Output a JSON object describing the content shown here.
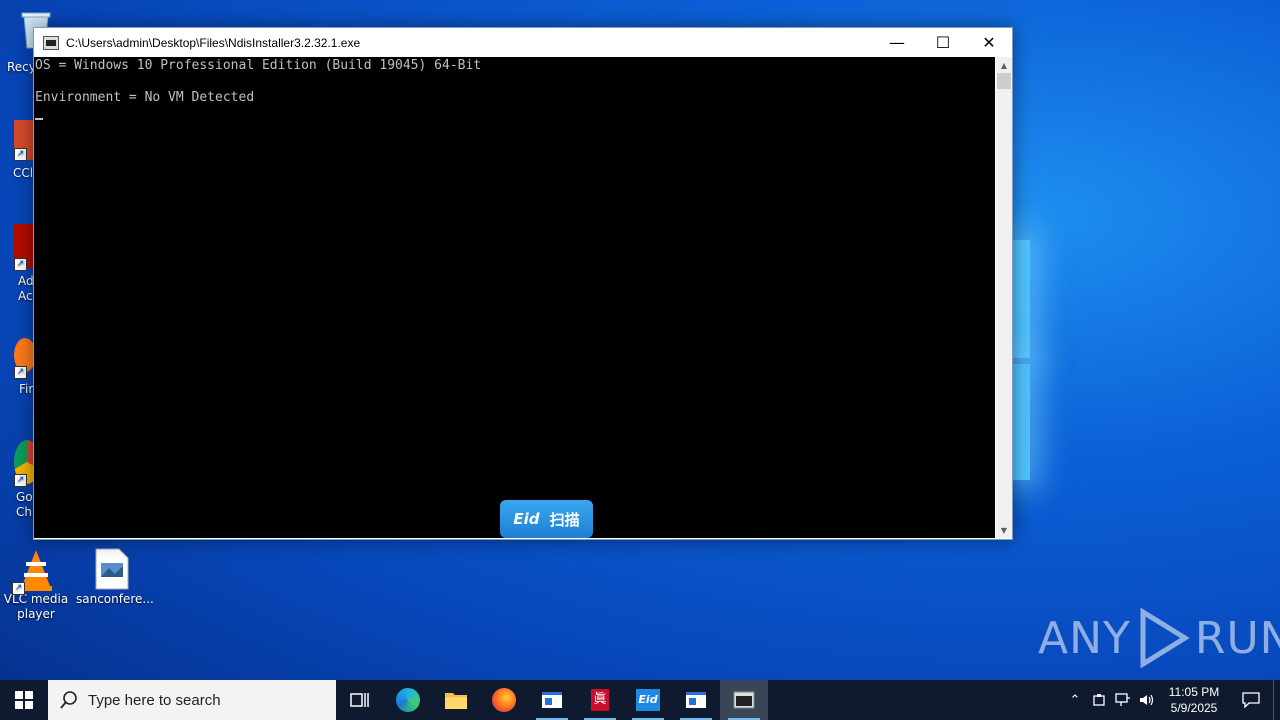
{
  "desktop": {
    "icons": [
      {
        "label": "Recy",
        "icon": "recycle-bin-icon"
      },
      {
        "label": "CCl",
        "icon": "ccleaner-icon"
      },
      {
        "label": "Ad\nAcr",
        "icon": "adobe-acrobat-icon"
      },
      {
        "label": "Fir",
        "icon": "firefox-icon"
      },
      {
        "label": "Go\nChr",
        "icon": "chrome-icon"
      },
      {
        "label": "VLC media\nplayer",
        "icon": "vlc-icon"
      },
      {
        "label": "sanconfere...",
        "icon": "image-file-icon"
      }
    ]
  },
  "window": {
    "title": "C:\\Users\\admin\\Desktop\\Files\\NdisInstaller3.2.32.1.exe",
    "minimize": "—",
    "maximize": "☐",
    "close": "✕",
    "console_lines": [
      "OS = Windows 10 Professional Edition (Build 19045) 64-Bit",
      "Environment = No VM Detected"
    ]
  },
  "eid_badge": {
    "logo": "Eid",
    "text": "扫描"
  },
  "watermark": {
    "left": "ANY",
    "right": "RUN"
  },
  "taskbar": {
    "search_placeholder": "Type here to search",
    "items": [
      "task-view",
      "edge",
      "file-explorer",
      "firefox",
      "app-window",
      "app-red",
      "eid",
      "app-window-2",
      "console"
    ],
    "clock_time": "11:05 PM",
    "clock_date": "5/9/2025"
  },
  "colors": {
    "taskbar": "#101a2e",
    "desktop_accent": "#0b5fd6",
    "console_bg": "#000000",
    "console_text": "#c0c0c0"
  }
}
